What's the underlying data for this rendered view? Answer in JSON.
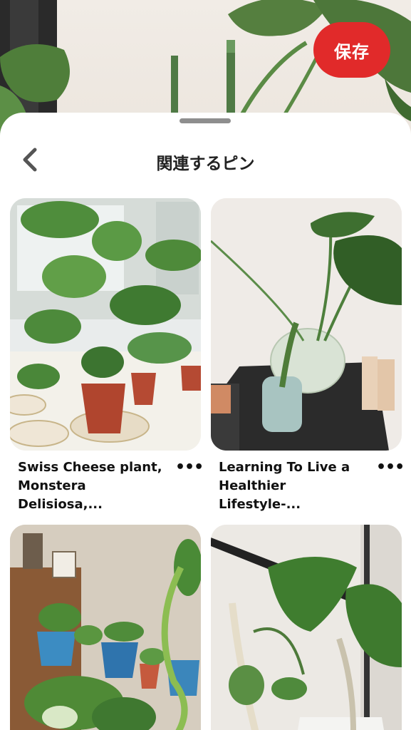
{
  "save_button": {
    "label": "保存"
  },
  "header": {
    "title": "関連するピン"
  },
  "pins": [
    {
      "title_line1": "Swiss Cheese plant,",
      "title_line2": "Monstera Delisiosa,...",
      "more_label": "•••"
    },
    {
      "title_line1": "Learning To Live a",
      "title_line2": "Healthier Lifestyle-...",
      "more_label": "•••"
    },
    {},
    {}
  ],
  "colors": {
    "accent": "#e12a2a",
    "text": "#111111",
    "sheet": "#ffffff"
  }
}
